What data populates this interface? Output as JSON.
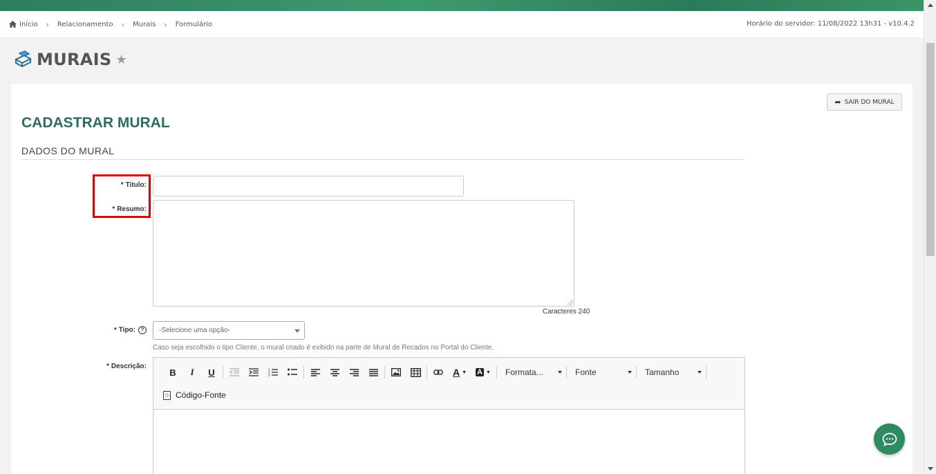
{
  "breadcrumb": {
    "items": [
      "Início",
      "Relacionamento",
      "Murais",
      "Formulário"
    ],
    "server_time": "Horário do servidor: 11/08/2022 13h31 - v10.4.2"
  },
  "page": {
    "title": "MURAIS"
  },
  "panel": {
    "exit_button": "SAIR DO MURAL",
    "form_title": "CADASTRAR MURAL",
    "section_title": "DADOS DO MURAL"
  },
  "form": {
    "titulo_label": "Titulo:",
    "resumo_label": "Resumo:",
    "char_count": "Caracteres 240",
    "tipo_label": "Tipo:",
    "tipo_placeholder": "-Selecione uma opção-",
    "tipo_hint": "Caso seja escolhido o tipo Cliente, o mural criado é exibido na parte de Mural de Recados no Portal do Cliente.",
    "descricao_label": "Descrição:",
    "required_mark": "*"
  },
  "editor": {
    "format_label": "Formata...",
    "font_label": "Fonte",
    "size_label": "Tamanho",
    "source_label": "Código-Fonte"
  },
  "colors": {
    "brand_green": "#2e8a63",
    "title_teal": "#2e6b63",
    "highlight_red": "#e30000"
  }
}
